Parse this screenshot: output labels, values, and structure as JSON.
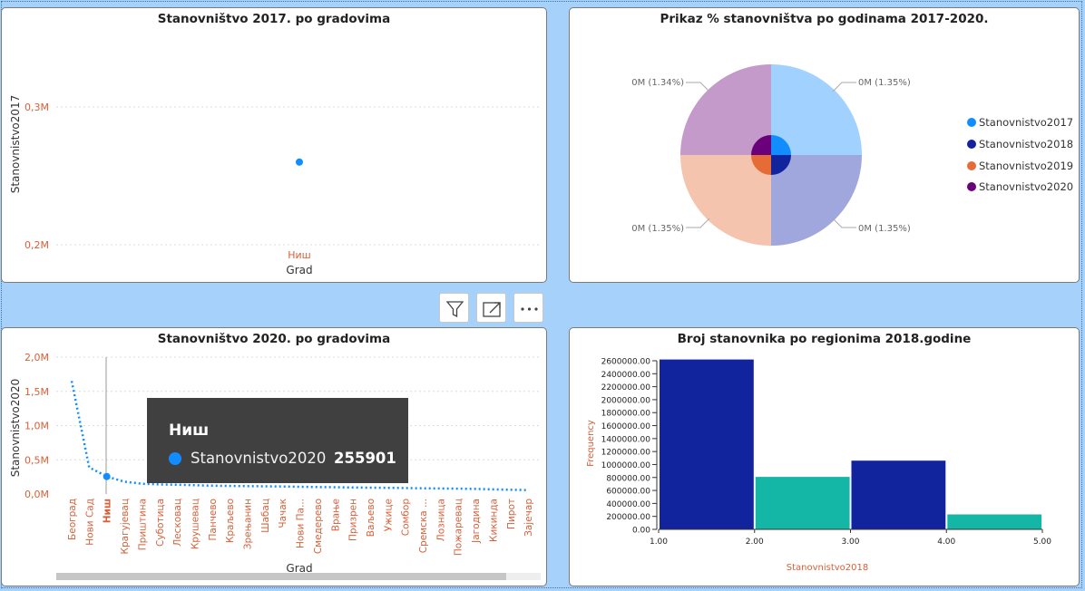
{
  "panels": {
    "scatter2017": {
      "title": "Stanovništvo 2017. po gradovima",
      "ylabel": "Stanovnistvo2017",
      "xlabel": "Grad",
      "ytick_top": "0,3M",
      "ytick_bottom": "0,2M",
      "category": "Ниш"
    },
    "pie": {
      "title": "Prikaz % stanovništva po godinama 2017-2020.",
      "labels": {
        "top_right": "0M (1.35%)",
        "top_left": "0M (1.34%)",
        "bottom_left": "0M (1.35%)",
        "bottom_right": "0M (1.35%)"
      },
      "legend": [
        {
          "label": "Stanovnistvo2017",
          "color": "#118dff"
        },
        {
          "label": "Stanovnistvo2018",
          "color": "#12239e"
        },
        {
          "label": "Stanovnistvo2019",
          "color": "#e66c37"
        },
        {
          "label": "Stanovnistvo2020",
          "color": "#6b007b"
        }
      ]
    },
    "line2020": {
      "title": "Stanovništvo 2020. po gradovima",
      "ylabel": "Stanovnistvo2020",
      "xlabel": "Grad",
      "yticks": [
        "2,0M",
        "1,5M",
        "1,0M",
        "0,5M",
        "0,0M"
      ],
      "categories": [
        "Београд",
        "Нови Сад",
        "Ниш",
        "Крагујевац",
        "Приштина",
        "Суботица",
        "Лесковац",
        "Крушевац",
        "Панчево",
        "Краљево",
        "Зрењанин",
        "Шабац",
        "Чачак",
        "Нови Па...",
        "Смедерево",
        "Врање",
        "Призрен",
        "Ваљево",
        "Ужице",
        "Сомбор",
        "Сремска ...",
        "Лозница",
        "Пожаревац",
        "Јагодина",
        "Кикинда",
        "Пирот",
        "Зајечар"
      ]
    },
    "histogram": {
      "title": "Broj stanovnika po regionima 2018.godine",
      "ylabel": "Frequency",
      "xlabel": "Stanovnistvo2018",
      "yticks": [
        "2600000.00",
        "2400000.00",
        "2200000.00",
        "2000000.00",
        "1800000.00",
        "1600000.00",
        "1400000.00",
        "1200000.00",
        "1000000.00",
        "800000.00",
        "600000.00",
        "400000.00",
        "200000.00",
        "0.00"
      ],
      "xticks": [
        "1.00",
        "2.00",
        "3.00",
        "4.00",
        "5.00"
      ]
    }
  },
  "tooltip": {
    "title": "Ниш",
    "series": "Stanovnistvo2020",
    "value": "255901"
  },
  "toolbar": {
    "icons": [
      "filter-icon",
      "focus-mode-icon",
      "more-options-icon"
    ]
  },
  "chart_data": [
    {
      "type": "scatter",
      "title": "Stanovništvo 2017. po gradovima",
      "xlabel": "Grad",
      "ylabel": "Stanovnistvo2017",
      "categories": [
        "Ниш"
      ],
      "values": [
        260000
      ],
      "ylim": [
        200000,
        300000
      ],
      "color": "#118dff"
    },
    {
      "type": "pie",
      "title": "Prikaz % stanovništva po godinama 2017-2020.",
      "categories": [
        "Stanovnistvo2017",
        "Stanovnistvo2018",
        "Stanovnistvo2019",
        "Stanovnistvo2020"
      ],
      "values": [
        1.35,
        1.35,
        1.35,
        1.34
      ],
      "legend_position": "right"
    },
    {
      "type": "line",
      "title": "Stanovništvo 2020. po gradovima",
      "xlabel": "Grad",
      "ylabel": "Stanovnistvo2020",
      "categories": [
        "Београд",
        "Нови Сад",
        "Ниш",
        "Крагујевац",
        "Приштина",
        "Суботица",
        "Лесковац",
        "Крушевац",
        "Панчево",
        "Краљево",
        "Зрењанин",
        "Шабац",
        "Чачак",
        "Нови Па...",
        "Смедерево",
        "Врање",
        "Призрен",
        "Ваљево",
        "Ужице",
        "Сомбор",
        "Сремска ...",
        "Лозница",
        "Пожаревац",
        "Јагодина",
        "Кикинда",
        "Пирот",
        "Зајечар"
      ],
      "series": [
        {
          "name": "Stanovnistvo2020",
          "values": [
            1650000,
            390000,
            255901,
            180000,
            150000,
            140000,
            135000,
            128000,
            122000,
            118000,
            115000,
            112000,
            110000,
            106000,
            102000,
            99000,
            96000,
            93000,
            90000,
            87000,
            84000,
            81000,
            78000,
            74000,
            68000,
            62000,
            57000
          ]
        }
      ],
      "ylim": [
        0,
        2000000
      ],
      "highlight": "Ниш",
      "color": "#118dff"
    },
    {
      "type": "bar",
      "title": "Broj stanovnika po regionima 2018.godine",
      "xlabel": "Stanovnistvo2018",
      "ylabel": "Frequency",
      "bins": [
        [
          1,
          2
        ],
        [
          2,
          3
        ],
        [
          3,
          4
        ],
        [
          4,
          5
        ]
      ],
      "values": [
        2620000,
        810000,
        1060000,
        230000
      ],
      "colors": [
        "#12239e",
        "#14b7a6",
        "#12239e",
        "#14b7a6"
      ],
      "ylim": [
        0,
        2600000
      ],
      "xlim": [
        1,
        5
      ]
    }
  ]
}
